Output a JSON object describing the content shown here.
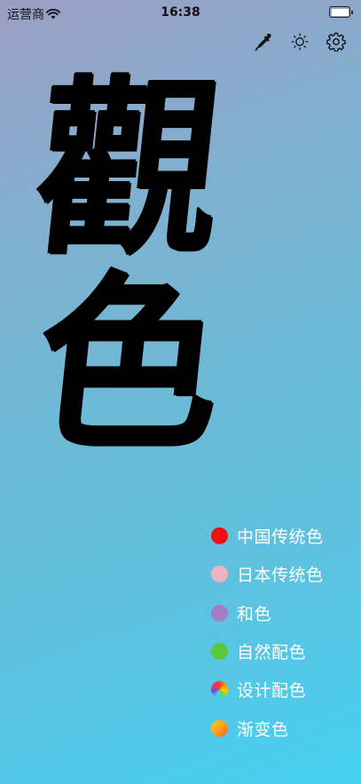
{
  "status_bar": {
    "carrier": "运营商",
    "time": "16:38"
  },
  "toolbar": {
    "icons": [
      "eyedropper-icon",
      "brightness-icon",
      "settings-gear-icon"
    ]
  },
  "title": {
    "char1": "觀",
    "char2": "色"
  },
  "menu": {
    "items": [
      {
        "label": "中国传统色",
        "color": "#ee1111"
      },
      {
        "label": "日本传统色",
        "color": "#efb3c4"
      },
      {
        "label": "和色",
        "color": "#a57bc4"
      },
      {
        "label": "自然配色",
        "color": "#5ac83a"
      },
      {
        "label": "设计配色",
        "color": "rainbow"
      },
      {
        "label": "渐变色",
        "color": "gradient-yellow-orange"
      }
    ]
  }
}
